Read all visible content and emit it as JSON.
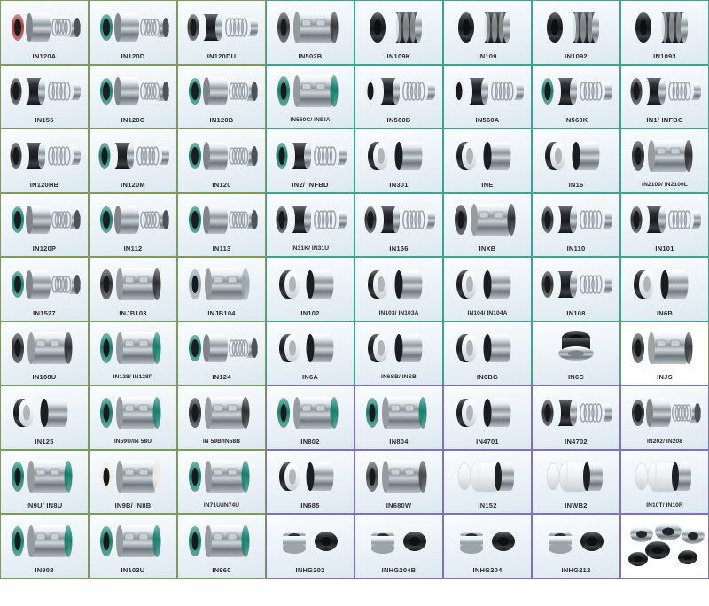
{
  "page": {
    "title": "Mechanical Seal Product Catalog Grid",
    "columns": 8,
    "rows": 10,
    "colors": {
      "border_olive": "#7d9a5d",
      "border_teal": "#3aa391",
      "border_purple": "#7b72c4",
      "cell_background_top": "#fbfdfe",
      "cell_background_bottom": "#dce8f0",
      "label_text": "#2b2b2b",
      "page_background": "#ffffff"
    }
  },
  "cells": [
    {
      "label": "IN120A",
      "border": "olive",
      "art": "seal-stack-3",
      "tint": "#b03a3a"
    },
    {
      "label": "IN120D",
      "border": "olive",
      "art": "seal-stack-3",
      "tint": "#18806f"
    },
    {
      "label": "IN120DU",
      "border": "olive",
      "art": "seal-spring",
      "tint": "#3a3a3a"
    },
    {
      "label": "IN502B",
      "border": "teal",
      "art": "seal-cart",
      "tint": "#3a3a3a"
    },
    {
      "label": "IN109K",
      "border": "teal",
      "art": "seal-bellow",
      "tint": "#2f2f2f"
    },
    {
      "label": "IN109",
      "border": "teal",
      "art": "seal-bellow",
      "tint": "#2f2f2f"
    },
    {
      "label": "IN1092",
      "border": "teal",
      "art": "seal-bellow",
      "tint": "#2f2f2f"
    },
    {
      "label": "IN1093",
      "border": "teal",
      "art": "seal-bellow",
      "tint": "#2f2f2f"
    },
    {
      "label": "IN155",
      "border": "olive",
      "art": "seal-spring",
      "tint": "#2f2f2f"
    },
    {
      "label": "IN120C",
      "border": "olive",
      "art": "seal-stack-3",
      "tint": "#18806f"
    },
    {
      "label": "IN120B",
      "border": "olive",
      "art": "seal-stack-3",
      "tint": "#18806f"
    },
    {
      "label": "IN560C/ INBIA",
      "border": "teal",
      "art": "seal-cart",
      "tint": "#18806f"
    },
    {
      "label": "IN560B",
      "border": "teal",
      "art": "seal-spring",
      "tint": "#e9eef2"
    },
    {
      "label": "IN560A",
      "border": "teal",
      "art": "seal-spring",
      "tint": "#e9eef2"
    },
    {
      "label": "IN560K",
      "border": "teal",
      "art": "seal-spring",
      "tint": "#18806f"
    },
    {
      "label": "IN1/ INFBC",
      "border": "teal",
      "art": "seal-spring",
      "tint": "#2f2f2f"
    },
    {
      "label": "IN120HB",
      "border": "olive",
      "art": "seal-spring",
      "tint": "#2f2f2f"
    },
    {
      "label": "IN120M",
      "border": "olive",
      "art": "seal-spring",
      "tint": "#18806f"
    },
    {
      "label": "IN120",
      "border": "olive",
      "art": "seal-stack-3",
      "tint": "#18806f"
    },
    {
      "label": "IN2/ INFBD",
      "border": "teal",
      "art": "seal-spring",
      "tint": "#18806f"
    },
    {
      "label": "IN301",
      "border": "teal",
      "art": "seal-pair",
      "tint": "#2f2f2f"
    },
    {
      "label": "INE",
      "border": "teal",
      "art": "seal-pair",
      "tint": "#2f2f2f"
    },
    {
      "label": "IN16",
      "border": "teal",
      "art": "seal-pair",
      "tint": "#2f2f2f"
    },
    {
      "label": "IN2100/ IN2100L",
      "border": "teal",
      "art": "seal-cart",
      "tint": "#2f2f2f"
    },
    {
      "label": "IN120P",
      "border": "olive",
      "art": "seal-stack-3",
      "tint": "#18806f"
    },
    {
      "label": "IN112",
      "border": "olive",
      "art": "seal-stack-3",
      "tint": "#18806f"
    },
    {
      "label": "IN113",
      "border": "olive",
      "art": "seal-stack-3",
      "tint": "#18806f"
    },
    {
      "label": "IN31K/ IN31U",
      "border": "teal",
      "art": "seal-spring",
      "tint": "#2f2f2f"
    },
    {
      "label": "IN156",
      "border": "teal",
      "art": "seal-spring",
      "tint": "#2f2f2f"
    },
    {
      "label": "INXB",
      "border": "teal",
      "art": "seal-cart",
      "tint": "#2f2f2f"
    },
    {
      "label": "IN110",
      "border": "teal",
      "art": "seal-spring",
      "tint": "#2f2f2f"
    },
    {
      "label": "IN101",
      "border": "teal",
      "art": "seal-spring",
      "tint": "#2f2f2f"
    },
    {
      "label": "IN1527",
      "border": "olive",
      "art": "seal-stack-3",
      "tint": "#18806f"
    },
    {
      "label": "INJB103",
      "border": "olive",
      "art": "seal-cart",
      "tint": "#2f2f2f"
    },
    {
      "label": "INJB104",
      "border": "olive",
      "art": "seal-cart",
      "tint": "#9aa7ad"
    },
    {
      "label": "IN102",
      "border": "teal",
      "art": "seal-pair",
      "tint": "#2f2f2f"
    },
    {
      "label": "IN103/ IN103A",
      "border": "teal",
      "art": "seal-pair",
      "tint": "#2f2f2f"
    },
    {
      "label": "IN104/ IN104A",
      "border": "teal",
      "art": "seal-pair",
      "tint": "#2f2f2f"
    },
    {
      "label": "IN108",
      "border": "teal",
      "art": "seal-spring",
      "tint": "#2f2f2f"
    },
    {
      "label": "IN6B",
      "border": "teal",
      "art": "seal-pair",
      "tint": "#2f2f2f"
    },
    {
      "label": "IN108U",
      "border": "olive",
      "art": "seal-cart",
      "tint": "#2f2f2f"
    },
    {
      "label": "IN128/ IN128P",
      "border": "olive",
      "art": "seal-cart",
      "tint": "#18806f"
    },
    {
      "label": "IN124",
      "border": "olive",
      "art": "seal-stack-3",
      "tint": "#18806f"
    },
    {
      "label": "IN6A",
      "border": "teal",
      "art": "seal-pair",
      "tint": "#2f2f2f"
    },
    {
      "label": "IN6SB/ INSB",
      "border": "teal",
      "art": "seal-pair",
      "tint": "#2f2f2f"
    },
    {
      "label": "IN6BG",
      "border": "teal",
      "art": "seal-pair",
      "tint": "#b99534"
    },
    {
      "label": "IN6C",
      "border": "teal",
      "art": "seal-single",
      "tint": "#2f2f2f"
    },
    {
      "label": "INJS",
      "border": "white",
      "art": "seal-cart",
      "tint": "#3b3b3b"
    },
    {
      "label": "IN125",
      "border": "olive",
      "art": "seal-pair",
      "tint": "#18806f"
    },
    {
      "label": "IN59U/IN 58U",
      "border": "olive",
      "art": "seal-cart",
      "tint": "#18806f"
    },
    {
      "label": "IN 59B/IN58B",
      "border": "olive",
      "art": "seal-cart",
      "tint": "#2f2f2f"
    },
    {
      "label": "IN802",
      "border": "purple",
      "art": "seal-cart",
      "tint": "#18806f"
    },
    {
      "label": "IN804",
      "border": "purple",
      "art": "seal-cart",
      "tint": "#18806f"
    },
    {
      "label": "IN4701",
      "border": "purple",
      "art": "seal-pair",
      "tint": "#2f2f2f"
    },
    {
      "label": "IN4702",
      "border": "purple",
      "art": "seal-spring",
      "tint": "#2f2f2f"
    },
    {
      "label": "IN202/ IN208",
      "border": "purple",
      "art": "seal-stack-3",
      "tint": "#2f2f2f"
    },
    {
      "label": "IN9U/ IN8U",
      "border": "olive",
      "art": "seal-cart",
      "tint": "#18806f"
    },
    {
      "label": "IN9B/ IN8B",
      "border": "olive",
      "art": "seal-cart",
      "tint": "#f0ece6"
    },
    {
      "label": "IN71U/IN74U",
      "border": "olive",
      "art": "seal-cart",
      "tint": "#18806f"
    },
    {
      "label": "IN685",
      "border": "purple",
      "art": "seal-pair",
      "tint": "#2f2f2f"
    },
    {
      "label": "IN680W",
      "border": "purple",
      "art": "seal-cart",
      "tint": "#4a4a4a"
    },
    {
      "label": "IN152",
      "border": "purple",
      "art": "seal-ptfe",
      "tint": "#f2f2f2"
    },
    {
      "label": "INWB2",
      "border": "purple",
      "art": "seal-ptfe",
      "tint": "#f2f2f2"
    },
    {
      "label": "IN10T/ IN10R",
      "border": "purple",
      "art": "seal-ptfe",
      "tint": "#f2f2f2"
    },
    {
      "label": "IN908",
      "border": "olive",
      "art": "seal-cart",
      "tint": "#18806f"
    },
    {
      "label": "IN102U",
      "border": "olive",
      "art": "seal-cart",
      "tint": "#18806f"
    },
    {
      "label": "IN960",
      "border": "olive",
      "art": "seal-cart",
      "tint": "#18806f"
    },
    {
      "label": "INHG202",
      "border": "purple",
      "art": "seal-hg",
      "tint": "#3b3b3b"
    },
    {
      "label": "INHG204B",
      "border": "purple",
      "art": "seal-hg",
      "tint": "#8d969c"
    },
    {
      "label": "INHG204",
      "border": "purple",
      "art": "seal-hg",
      "tint": "#3b3b3b"
    },
    {
      "label": "INHG212",
      "border": "purple",
      "art": "seal-hg",
      "tint": "#3b3b3b"
    },
    {
      "label": "",
      "border": "purple",
      "art": "seal-group",
      "tint": "#4a4a4a"
    }
  ]
}
